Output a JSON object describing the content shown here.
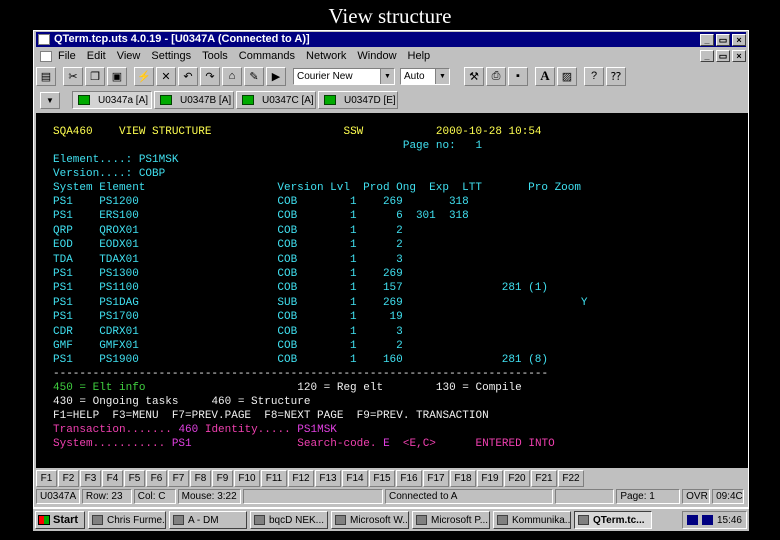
{
  "slide": {
    "title": "View structure"
  },
  "window": {
    "title": "QTerm.tcp.uts 4.0.19 - [U0347A (Connected to A)]",
    "controls": {
      "minimize": "_",
      "restore": "▭",
      "close": "×"
    },
    "doc_controls": {
      "minimize": "_",
      "restore": "▭",
      "close": "×"
    }
  },
  "menu": [
    "File",
    "Edit",
    "View",
    "Settings",
    "Tools",
    "Commands",
    "Network",
    "Window",
    "Help"
  ],
  "toolbar": {
    "font_combo": "Courier New",
    "size_combo": "Auto",
    "icons": [
      "printer-icon",
      "scissors-icon",
      "copy-icon",
      "paste-icon",
      "connect-icon",
      "disconnect-icon",
      "undo-icon",
      "redo-icon",
      "home-icon",
      "edit-icon",
      "play-icon"
    ],
    "icons_right": [
      "hammer-icon",
      "print-icon",
      "save-icon",
      "font-icon",
      "image-icon",
      "help-icon",
      "whats-this-icon"
    ],
    "font_label": "A",
    "help_label": "?"
  },
  "tabs": {
    "arrow": "▼",
    "items": [
      {
        "label": "U0347a [A]",
        "active": true
      },
      {
        "label": "U0347B [A]",
        "active": false
      },
      {
        "label": "U0347C [A]",
        "active": false
      },
      {
        "label": "U0347D [E]",
        "active": false
      }
    ]
  },
  "terminal": {
    "header": {
      "program": "SQA460",
      "screen": "VIEW STRUCTURE",
      "system": "SSW",
      "datetime": "2000-10-28 10:54",
      "page_label": "Page no:",
      "page_no": "1"
    },
    "element_label": "Element....:",
    "element": "PS1MSK",
    "version_label": "Version....:",
    "version": "COBP",
    "columns": [
      "System",
      "Element",
      "Version",
      "Lvl",
      "Prod",
      "Ong",
      "Exp",
      "LTT",
      "Pro",
      "Zoom"
    ],
    "rows": [
      {
        "system": "PS1",
        "element": "PS1200",
        "version": "COB",
        "lvl": "1",
        "prod": "269",
        "ong": "",
        "exp": "318",
        "ltt": "",
        "pro": ""
      },
      {
        "system": "PS1",
        "element": "ERS100",
        "version": "COB",
        "lvl": "1",
        "prod": "6",
        "ong": "301",
        "exp": "318",
        "ltt": "",
        "pro": ""
      },
      {
        "system": "QRP",
        "element": "QROX01",
        "version": "COB",
        "lvl": "1",
        "prod": "2",
        "ong": "",
        "exp": "",
        "ltt": "",
        "pro": ""
      },
      {
        "system": "EOD",
        "element": "EODX01",
        "version": "COB",
        "lvl": "1",
        "prod": "2",
        "ong": "",
        "exp": "",
        "ltt": "",
        "pro": ""
      },
      {
        "system": "TDA",
        "element": "TDAX01",
        "version": "COB",
        "lvl": "1",
        "prod": "3",
        "ong": "",
        "exp": "",
        "ltt": "",
        "pro": ""
      },
      {
        "system": "PS1",
        "element": "PS1300",
        "version": "COB",
        "lvl": "1",
        "prod": "269",
        "ong": "",
        "exp": "",
        "ltt": "",
        "pro": ""
      },
      {
        "system": "PS1",
        "element": "PS1100",
        "version": "COB",
        "lvl": "1",
        "prod": "157",
        "ong": "",
        "exp": "",
        "ltt": "281 (1)",
        "pro": ""
      },
      {
        "system": "PS1",
        "element": "PS1DAG",
        "version": "SUB",
        "lvl": "1",
        "prod": "269",
        "ong": "",
        "exp": "",
        "ltt": "",
        "pro": "Y"
      },
      {
        "system": "PS1",
        "element": "PS1700",
        "version": "COB",
        "lvl": "1",
        "prod": "19",
        "ong": "",
        "exp": "",
        "ltt": "",
        "pro": ""
      },
      {
        "system": "CDR",
        "element": "CDRX01",
        "version": "COB",
        "lvl": "1",
        "prod": "3",
        "ong": "",
        "exp": "",
        "ltt": "",
        "pro": ""
      },
      {
        "system": "GMF",
        "element": "GMFX01",
        "version": "COB",
        "lvl": "1",
        "prod": "2",
        "ong": "",
        "exp": "",
        "ltt": "",
        "pro": ""
      },
      {
        "system": "PS1",
        "element": "PS1900",
        "version": "COB",
        "lvl": "1",
        "prod": "160",
        "ong": "",
        "exp": "",
        "ltt": "281 (8)",
        "pro": ""
      }
    ],
    "separator": "---------------------------------------------------------------------------",
    "legend": [
      {
        "text": "450 = Elt info",
        "color": "g"
      },
      {
        "text": "120 = Reg elt",
        "color": "w"
      },
      {
        "text": "130 = Compile",
        "color": "w"
      },
      {
        "text": "430 = Ongoing tasks",
        "color": "w"
      },
      {
        "text": "460 = Structure",
        "color": "w"
      }
    ],
    "fkey_help": "F1=HELP  F3=MENU  F7=PREV.PAGE  F8=NEXT PAGE  F9=PREV. TRANSACTION",
    "transaction_label": "Transaction.......",
    "transaction_value": "460",
    "identity_label": "Identity.....",
    "identity_value": "PS1MSK",
    "system_label": "System...........",
    "system_value": "PS1",
    "search_label": "Search-code.",
    "search_value": "E",
    "search_hint": "<E,C>",
    "entered": "ENTERED INTO"
  },
  "fkeys": [
    "F1",
    "F2",
    "F3",
    "F4",
    "F5",
    "F6",
    "F7",
    "F8",
    "F9",
    "F10",
    "F11",
    "F12",
    "F13",
    "F14",
    "F15",
    "F16",
    "F17",
    "F18",
    "F19",
    "F20",
    "F21",
    "F22"
  ],
  "status": {
    "session": "U0347A",
    "row": "Row: 23",
    "col": "Col: C",
    "mouse": "Mouse: 3:22",
    "connection": "Connected to A",
    "page": "Page: 1",
    "mode": "OVR",
    "time": "09:4C"
  },
  "taskbar": {
    "start": "Start",
    "tasks": [
      {
        "label": "Chris Furme...",
        "active": false
      },
      {
        "label": "A - DM",
        "active": false
      },
      {
        "label": "bqcD NEK...",
        "active": false
      },
      {
        "label": "Microsoft W...",
        "active": false
      },
      {
        "label": "Microsoft P...",
        "active": false
      },
      {
        "label": "Kommunika...",
        "active": false
      },
      {
        "label": "QTerm.tc...",
        "active": true
      }
    ],
    "clock": "15:46"
  }
}
